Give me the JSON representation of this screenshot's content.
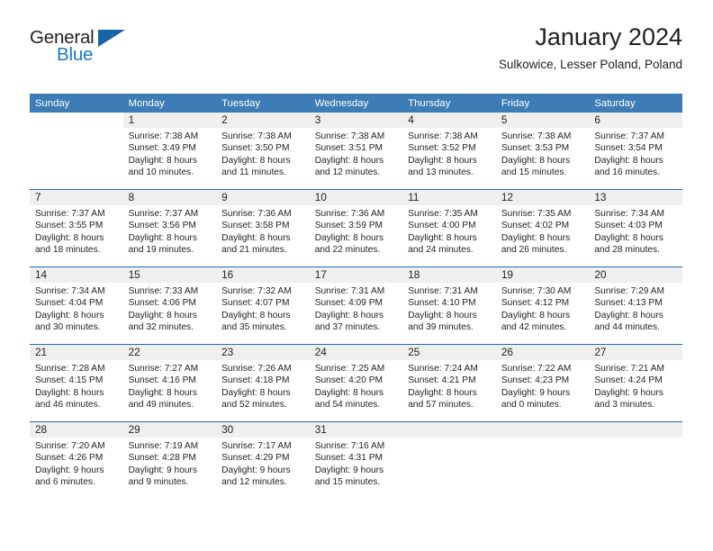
{
  "brand": {
    "name_dark": "General",
    "name_blue": "Blue",
    "accent_color": "#1b7ac4",
    "header_color": "#3d7cb5"
  },
  "header": {
    "title": "January 2024",
    "subtitle": "Sulkowice, Lesser Poland, Poland"
  },
  "weekdays": [
    "Sunday",
    "Monday",
    "Tuesday",
    "Wednesday",
    "Thursday",
    "Friday",
    "Saturday"
  ],
  "weeks": [
    [
      {
        "day": "",
        "lines": []
      },
      {
        "day": "1",
        "lines": [
          "Sunrise: 7:38 AM",
          "Sunset: 3:49 PM",
          "Daylight: 8 hours",
          "and 10 minutes."
        ]
      },
      {
        "day": "2",
        "lines": [
          "Sunrise: 7:38 AM",
          "Sunset: 3:50 PM",
          "Daylight: 8 hours",
          "and 11 minutes."
        ]
      },
      {
        "day": "3",
        "lines": [
          "Sunrise: 7:38 AM",
          "Sunset: 3:51 PM",
          "Daylight: 8 hours",
          "and 12 minutes."
        ]
      },
      {
        "day": "4",
        "lines": [
          "Sunrise: 7:38 AM",
          "Sunset: 3:52 PM",
          "Daylight: 8 hours",
          "and 13 minutes."
        ]
      },
      {
        "day": "5",
        "lines": [
          "Sunrise: 7:38 AM",
          "Sunset: 3:53 PM",
          "Daylight: 8 hours",
          "and 15 minutes."
        ]
      },
      {
        "day": "6",
        "lines": [
          "Sunrise: 7:37 AM",
          "Sunset: 3:54 PM",
          "Daylight: 8 hours",
          "and 16 minutes."
        ]
      }
    ],
    [
      {
        "day": "7",
        "lines": [
          "Sunrise: 7:37 AM",
          "Sunset: 3:55 PM",
          "Daylight: 8 hours",
          "and 18 minutes."
        ]
      },
      {
        "day": "8",
        "lines": [
          "Sunrise: 7:37 AM",
          "Sunset: 3:56 PM",
          "Daylight: 8 hours",
          "and 19 minutes."
        ]
      },
      {
        "day": "9",
        "lines": [
          "Sunrise: 7:36 AM",
          "Sunset: 3:58 PM",
          "Daylight: 8 hours",
          "and 21 minutes."
        ]
      },
      {
        "day": "10",
        "lines": [
          "Sunrise: 7:36 AM",
          "Sunset: 3:59 PM",
          "Daylight: 8 hours",
          "and 22 minutes."
        ]
      },
      {
        "day": "11",
        "lines": [
          "Sunrise: 7:35 AM",
          "Sunset: 4:00 PM",
          "Daylight: 8 hours",
          "and 24 minutes."
        ]
      },
      {
        "day": "12",
        "lines": [
          "Sunrise: 7:35 AM",
          "Sunset: 4:02 PM",
          "Daylight: 8 hours",
          "and 26 minutes."
        ]
      },
      {
        "day": "13",
        "lines": [
          "Sunrise: 7:34 AM",
          "Sunset: 4:03 PM",
          "Daylight: 8 hours",
          "and 28 minutes."
        ]
      }
    ],
    [
      {
        "day": "14",
        "lines": [
          "Sunrise: 7:34 AM",
          "Sunset: 4:04 PM",
          "Daylight: 8 hours",
          "and 30 minutes."
        ]
      },
      {
        "day": "15",
        "lines": [
          "Sunrise: 7:33 AM",
          "Sunset: 4:06 PM",
          "Daylight: 8 hours",
          "and 32 minutes."
        ]
      },
      {
        "day": "16",
        "lines": [
          "Sunrise: 7:32 AM",
          "Sunset: 4:07 PM",
          "Daylight: 8 hours",
          "and 35 minutes."
        ]
      },
      {
        "day": "17",
        "lines": [
          "Sunrise: 7:31 AM",
          "Sunset: 4:09 PM",
          "Daylight: 8 hours",
          "and 37 minutes."
        ]
      },
      {
        "day": "18",
        "lines": [
          "Sunrise: 7:31 AM",
          "Sunset: 4:10 PM",
          "Daylight: 8 hours",
          "and 39 minutes."
        ]
      },
      {
        "day": "19",
        "lines": [
          "Sunrise: 7:30 AM",
          "Sunset: 4:12 PM",
          "Daylight: 8 hours",
          "and 42 minutes."
        ]
      },
      {
        "day": "20",
        "lines": [
          "Sunrise: 7:29 AM",
          "Sunset: 4:13 PM",
          "Daylight: 8 hours",
          "and 44 minutes."
        ]
      }
    ],
    [
      {
        "day": "21",
        "lines": [
          "Sunrise: 7:28 AM",
          "Sunset: 4:15 PM",
          "Daylight: 8 hours",
          "and 46 minutes."
        ]
      },
      {
        "day": "22",
        "lines": [
          "Sunrise: 7:27 AM",
          "Sunset: 4:16 PM",
          "Daylight: 8 hours",
          "and 49 minutes."
        ]
      },
      {
        "day": "23",
        "lines": [
          "Sunrise: 7:26 AM",
          "Sunset: 4:18 PM",
          "Daylight: 8 hours",
          "and 52 minutes."
        ]
      },
      {
        "day": "24",
        "lines": [
          "Sunrise: 7:25 AM",
          "Sunset: 4:20 PM",
          "Daylight: 8 hours",
          "and 54 minutes."
        ]
      },
      {
        "day": "25",
        "lines": [
          "Sunrise: 7:24 AM",
          "Sunset: 4:21 PM",
          "Daylight: 8 hours",
          "and 57 minutes."
        ]
      },
      {
        "day": "26",
        "lines": [
          "Sunrise: 7:22 AM",
          "Sunset: 4:23 PM",
          "Daylight: 9 hours",
          "and 0 minutes."
        ]
      },
      {
        "day": "27",
        "lines": [
          "Sunrise: 7:21 AM",
          "Sunset: 4:24 PM",
          "Daylight: 9 hours",
          "and 3 minutes."
        ]
      }
    ],
    [
      {
        "day": "28",
        "lines": [
          "Sunrise: 7:20 AM",
          "Sunset: 4:26 PM",
          "Daylight: 9 hours",
          "and 6 minutes."
        ]
      },
      {
        "day": "29",
        "lines": [
          "Sunrise: 7:19 AM",
          "Sunset: 4:28 PM",
          "Daylight: 9 hours",
          "and 9 minutes."
        ]
      },
      {
        "day": "30",
        "lines": [
          "Sunrise: 7:17 AM",
          "Sunset: 4:29 PM",
          "Daylight: 9 hours",
          "and 12 minutes."
        ]
      },
      {
        "day": "31",
        "lines": [
          "Sunrise: 7:16 AM",
          "Sunset: 4:31 PM",
          "Daylight: 9 hours",
          "and 15 minutes."
        ]
      },
      {
        "day": "",
        "lines": []
      },
      {
        "day": "",
        "lines": []
      },
      {
        "day": "",
        "lines": []
      }
    ]
  ]
}
